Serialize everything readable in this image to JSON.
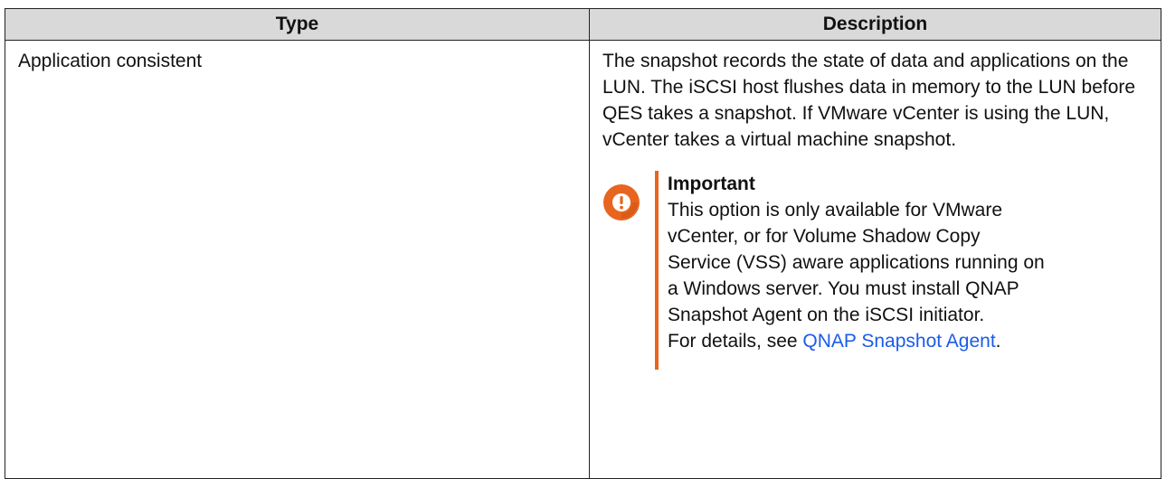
{
  "table": {
    "headers": {
      "type": "Type",
      "description": "Description"
    },
    "rows": [
      {
        "type": "Application consistent",
        "description": "The snapshot records the state of data and applications on the LUN. The iSCSI host flushes data in memory to the LUN before QES takes a snapshot. If VMware vCenter is using the LUN, vCenter takes a virtual machine snapshot.",
        "note": {
          "icon": "important-exclamation-icon",
          "title": "Important",
          "body": "This option is only available for VMware vCenter, or for Volume Shadow Copy Service (VSS) aware applications running on a Windows server. You must install QNAP Snapshot Agent on the iSCSI initiator.",
          "details_prefix": "For details, see ",
          "details_link": "QNAP Snapshot Agent",
          "details_suffix": "."
        }
      }
    ]
  },
  "colors": {
    "header_bg": "#d9d9d9",
    "accent": "#e8651f",
    "link": "#1a5ce8"
  }
}
